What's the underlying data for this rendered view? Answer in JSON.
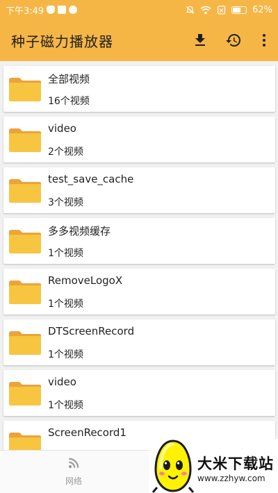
{
  "status_bar": {
    "time": "下午3:49",
    "battery": "62%",
    "battery_level": 0.62
  },
  "app_bar": {
    "title": "种子磁力播放器",
    "download_icon": "download-icon",
    "history_icon": "history-icon",
    "more_icon": "more-vert-icon"
  },
  "folders": [
    {
      "name": "全部视频",
      "count": "16个视频"
    },
    {
      "name": "video",
      "count": "2个视频"
    },
    {
      "name": "test_save_cache",
      "count": "3个视频"
    },
    {
      "name": "多多视频缓存",
      "count": "1个视频"
    },
    {
      "name": "RemoveLogoX",
      "count": "1个视频"
    },
    {
      "name": "DTScreenRecord",
      "count": "1个视频"
    },
    {
      "name": "video",
      "count": "1个视频"
    },
    {
      "name": "ScreenRecord1",
      "count": ""
    }
  ],
  "bottom_nav": {
    "network_label": "网络",
    "network_icon": "rss-icon"
  },
  "watermark": {
    "title": "大米下载站",
    "url": "www.zzhyw.com"
  },
  "colors": {
    "accent": "#f5b646",
    "folder": "#f7c540",
    "folder_tab": "#eba33a"
  }
}
